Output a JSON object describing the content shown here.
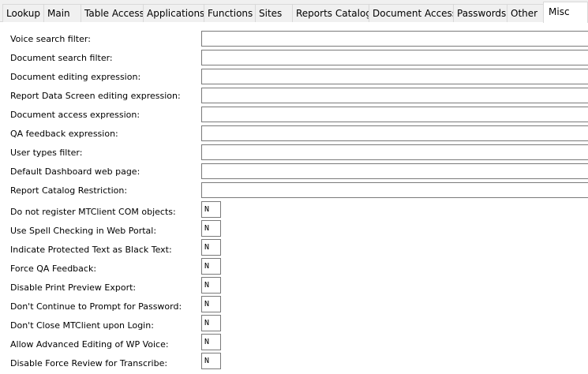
{
  "tabs": [
    {
      "label": "Lookup",
      "active": false
    },
    {
      "label": "Main",
      "active": false
    },
    {
      "label": "Table Access",
      "active": false
    },
    {
      "label": "Applications",
      "active": false
    },
    {
      "label": "Functions",
      "active": false
    },
    {
      "label": "Sites",
      "active": false
    },
    {
      "label": "Reports Catalog",
      "active": false
    },
    {
      "label": "Document Access",
      "active": false
    },
    {
      "label": "Passwords",
      "active": false
    },
    {
      "label": "Other",
      "active": false
    },
    {
      "label": "Misc",
      "active": true
    }
  ],
  "text_settings": [
    {
      "label": "Voice search filter:",
      "value": ""
    },
    {
      "label": "Document search filter:",
      "value": ""
    },
    {
      "label": "Document editing expression:",
      "value": ""
    },
    {
      "label": "Report Data Screen editing expression:",
      "value": ""
    },
    {
      "label": "Document access expression:",
      "value": ""
    },
    {
      "label": "QA feedback expression:",
      "value": ""
    },
    {
      "label": "User types filter:",
      "value": ""
    },
    {
      "label": "Default Dashboard web page:",
      "value": ""
    },
    {
      "label": "Report Catalog Restriction:",
      "value": ""
    }
  ],
  "flag_settings": [
    {
      "label": "Do not register MTClient COM objects:",
      "value": "N"
    },
    {
      "label": "Use Spell Checking in Web Portal:",
      "value": "N"
    },
    {
      "label": "Indicate Protected Text as Black Text:",
      "value": "N"
    },
    {
      "label": "Force QA Feedback:",
      "value": "N"
    },
    {
      "label": "Disable Print Preview Export:",
      "value": "N"
    },
    {
      "label": "Don't Continue to Prompt for Password:",
      "value": "N"
    },
    {
      "label": "Don't Close MTClient upon Login:",
      "value": "N"
    },
    {
      "label": "Allow Advanced Editing of WP Voice:",
      "value": "N"
    },
    {
      "label": "Disable Force Review for Transcribe:",
      "value": "N"
    }
  ]
}
